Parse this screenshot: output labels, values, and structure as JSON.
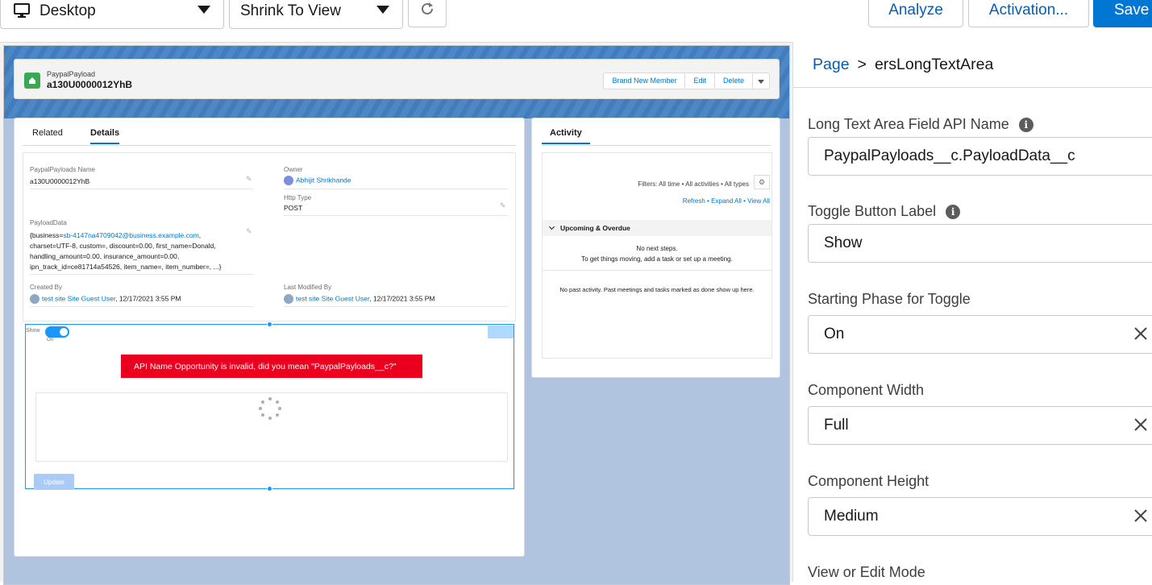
{
  "toolbar": {
    "device": "Desktop",
    "zoom": "Shrink To View",
    "analyze": "Analyze",
    "activation": "Activation...",
    "save": "Save"
  },
  "record": {
    "type": "PaypalPayload",
    "name": "a130U0000012YhB",
    "actions": [
      "Brand New Member",
      "Edit",
      "Delete"
    ]
  },
  "tabs": {
    "related": "Related",
    "details": "Details"
  },
  "details": {
    "name_label": "PaypalPayloads Name",
    "name_value": "a130U0000012YhB",
    "owner_label": "Owner",
    "owner_value": "Abhijit Shrikhande",
    "http_label": "Http Type",
    "http_value": "POST",
    "payload_label": "PayloadData",
    "payload_prefix": "{business=",
    "payload_email": "sb-4147na4709042@business.example.com",
    "payload_line1_end": ",",
    "payload_line2": "charset=UTF-8, custom=, discount=0.00, first_name=Donald,",
    "payload_line3": "handling_amount=0.00, insurance_amount=0.00,",
    "payload_line4": "ipn_track_id=ce81714a54526, item_name=, item_number=, ...}",
    "created_label": "Created By",
    "created_user": "test site Site Guest User",
    "created_date": ", 12/17/2021 3:55 PM",
    "modified_label": "Last Modified By",
    "modified_user": "test site Site Guest User",
    "modified_date": ", 12/17/2021 3:55 PM"
  },
  "component": {
    "toggle_label": "Show",
    "toggle_state": "On",
    "error": "API Name Opportunity is invalid, did you mean \"PaypalPayloads__c?\"",
    "update": "Update"
  },
  "activity": {
    "tab": "Activity",
    "filters": "Filters: All time • All activities • All types",
    "refresh": "Refresh",
    "expand": "Expand All",
    "view": "View All",
    "upcoming": "Upcoming & Overdue",
    "no_steps": "No next steps.",
    "no_steps_hint": "To get things moving, add a task or set up a meeting.",
    "no_past": "No past activity. Past meetings and tasks marked as done show up here."
  },
  "panel": {
    "crumb_page": "Page",
    "crumb_sep": ">",
    "crumb_current": "ersLongTextArea",
    "api_label": "Long Text Area Field API Name",
    "api_value": "PaypalPayloads__c.PayloadData__c",
    "toggle_label": "Toggle Button Label",
    "toggle_value": "Show",
    "phase_label": "Starting Phase for Toggle",
    "phase_value": "On",
    "width_label": "Component Width",
    "width_value": "Full",
    "height_label": "Component Height",
    "height_value": "Medium",
    "mode_label": "View or Edit Mode"
  },
  "colors": {
    "brand": "#0176d3",
    "error": "#ea001e",
    "record_icon": "#3ba755"
  }
}
